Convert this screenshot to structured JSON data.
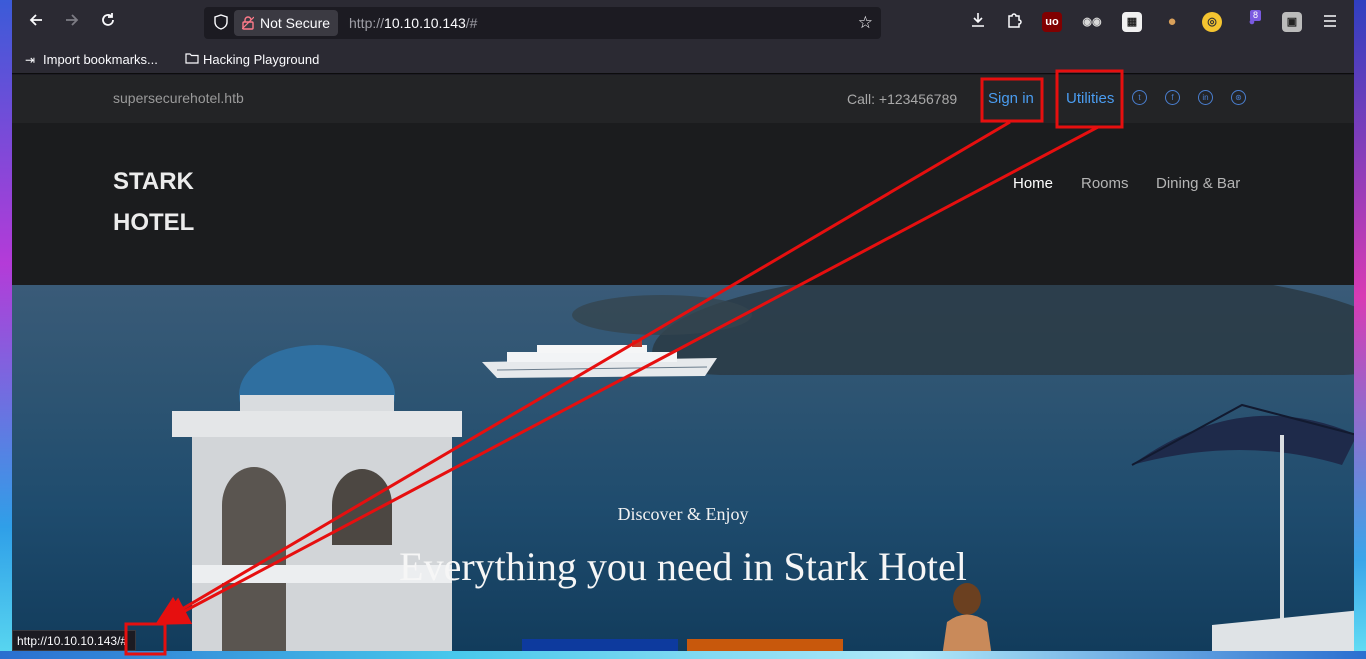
{
  "browser": {
    "security_label": "Not Secure",
    "url_prefix": "http://",
    "url_host": "10.10.10.143",
    "url_suffix": "/#",
    "extension_badge": "8",
    "bookmarks": [
      {
        "label": "Import bookmarks...",
        "icon": "import-icon"
      },
      {
        "label": "Hacking Playground",
        "icon": "folder-icon"
      }
    ],
    "status_url": "http://10.10.10.143/#"
  },
  "site": {
    "domain": "supersecurehotel.htb",
    "call": "Call: +123456789",
    "sign_in": "Sign in",
    "utilities": "Utilities",
    "logo_line1": "STARK",
    "logo_line2": "HOTEL",
    "nav": [
      {
        "label": "Home",
        "active": true
      },
      {
        "label": "Rooms",
        "active": false
      },
      {
        "label": "Dining & Bar",
        "active": false
      }
    ],
    "hero_subtitle": "Discover & Enjoy",
    "hero_title": "Everything you need in Stark Hotel"
  },
  "colors": {
    "annotation": "#e60f0f",
    "link": "#4a9cf0",
    "cta_blue": "#0d3a9e",
    "cta_orange": "#c8580c"
  }
}
